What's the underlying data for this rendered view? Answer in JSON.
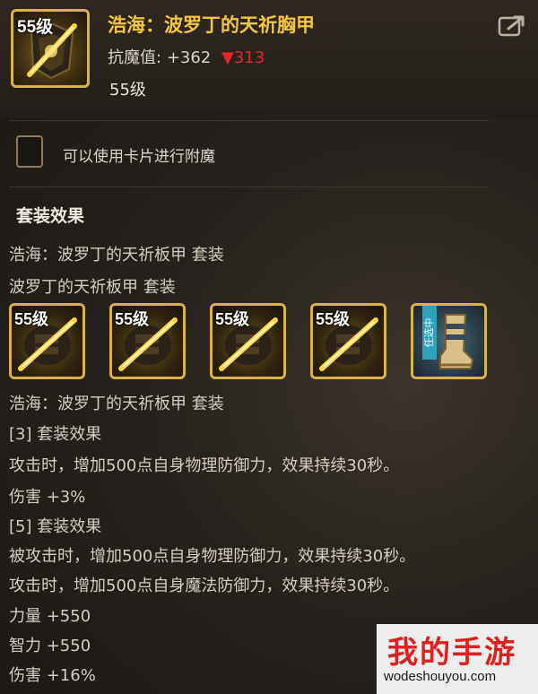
{
  "item": {
    "level_badge": "55级",
    "name": "浩海：波罗丁的天祈胸甲",
    "stat_label": "抗魔值:",
    "stat_value": "+362",
    "stat_change_arrow": "▼",
    "stat_change": "313",
    "required_level": "55级",
    "icon": "chest-armor-icon"
  },
  "enchant": {
    "checkbox_label": "可以使用卡片进行附魔",
    "checked": false
  },
  "set_section": {
    "title": "套装效果",
    "set_full_name": "浩海：波罗丁的天祈板甲  套装",
    "set_short_name": "波罗丁的天祈板甲  套装",
    "slots": [
      {
        "badge": "55级",
        "icon": "gauntlet-icon"
      },
      {
        "badge": "55级",
        "icon": "gauntlet-icon"
      },
      {
        "badge": "55级",
        "icon": "gauntlet-icon"
      },
      {
        "badge": "55级",
        "icon": "gauntlet-icon"
      },
      {
        "badge": "",
        "icon": "boots-icon",
        "ribbon": "任选中"
      }
    ],
    "lines": [
      "浩海：波罗丁的天祈板甲 套装",
      "[3] 套装效果",
      "攻击时，增加500点自身物理防御力，效果持续30秒。",
      "伤害 +3%",
      "[5] 套装效果",
      "被攻击时，增加500点自身物理防御力，效果持续30秒。",
      "攻击时，增加500点自身魔法防御力，效果持续30秒。",
      "力量 +550",
      "智力 +550",
      "伤害 +16%"
    ]
  },
  "watermark": {
    "title": "我的手游",
    "url": "wodeshouyou.com"
  },
  "colors": {
    "gold": "#f3c545",
    "frame": "#d8b24a",
    "down_red": "#e2262a",
    "watermark_red": "#e0201c"
  }
}
